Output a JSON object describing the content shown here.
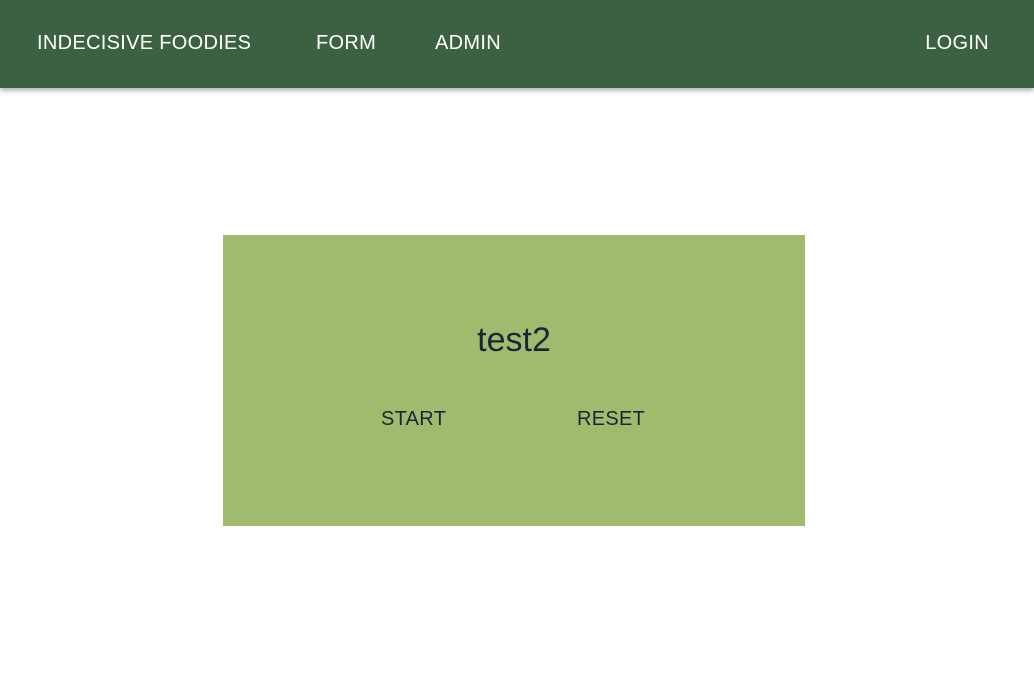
{
  "navbar": {
    "brand": "INDECISIVE FOODIES",
    "links": [
      "FORM",
      "ADMIN"
    ],
    "login": "LOGIN"
  },
  "card": {
    "title": "test2",
    "start_label": "START",
    "reset_label": "RESET"
  },
  "colors": {
    "navbar_bg": "#3b6142",
    "card_bg": "#a0bb6e",
    "card_text": "#1a2538"
  }
}
